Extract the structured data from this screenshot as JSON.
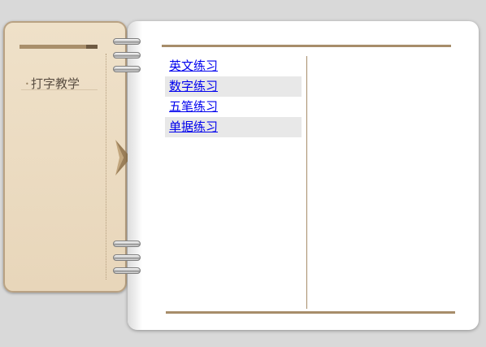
{
  "sidebar": {
    "title": "打字教学"
  },
  "menu": {
    "items": [
      {
        "label": "英文练习"
      },
      {
        "label": "数字练习"
      },
      {
        "label": "五笔练习"
      },
      {
        "label": "单据练习"
      }
    ]
  },
  "colors": {
    "accent": "#a78d6a",
    "sidebar_bg": "#efe1c9",
    "link": "#0000ee",
    "row_shade": "#e8e8e8"
  }
}
